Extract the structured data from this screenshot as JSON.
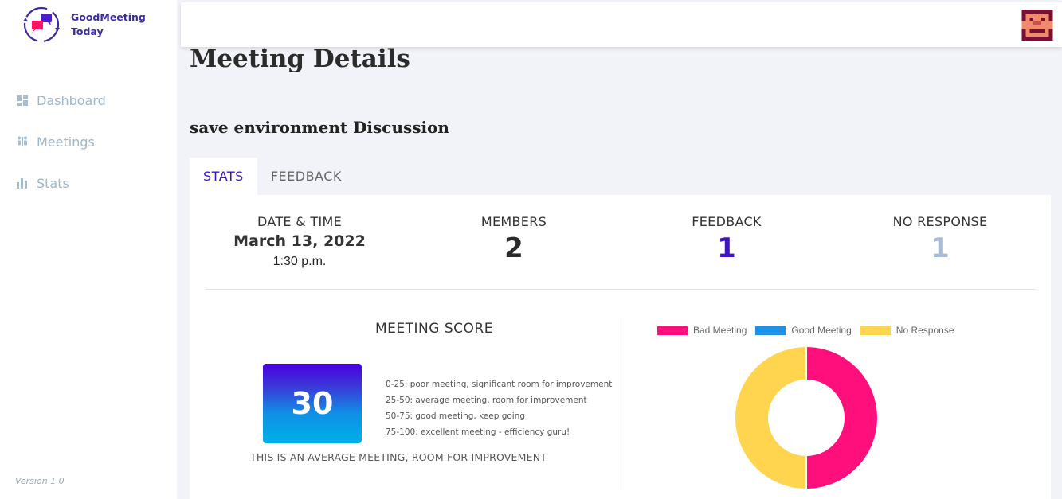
{
  "app": {
    "logo_line1": "GoodMeeting",
    "logo_line2": "Today",
    "version": "Version 1.0"
  },
  "sidebar": {
    "items": [
      {
        "label": "Dashboard",
        "icon": "dashboard-icon"
      },
      {
        "label": "Meetings",
        "icon": "meetings-icon"
      },
      {
        "label": "Stats",
        "icon": "bar-chart-icon"
      }
    ]
  },
  "header": {
    "avatar": "user-avatar"
  },
  "page": {
    "title": "Meeting Details",
    "meeting_name": "save environment Discussion"
  },
  "tabs": [
    {
      "label": "STATS",
      "active": true
    },
    {
      "label": "FEEDBACK",
      "active": false
    }
  ],
  "stats": {
    "date_label": "DATE & TIME",
    "date": "March 13, 2022",
    "time": "1:30 p.m.",
    "members_label": "MEMBERS",
    "members": "2",
    "feedback_label": "FEEDBACK",
    "feedback": "1",
    "no_response_label": "NO RESPONSE",
    "no_response": "1"
  },
  "score": {
    "title": "MEETING SCORE",
    "value": "30",
    "legend": [
      "0-25: poor meeting, significant room for improvement",
      "25-50: average meeting, room for improvement",
      "50-75: good meeting, keep going",
      "75-100: excellent meeting - efficiency guru!"
    ],
    "caption": "THIS IS AN AVERAGE MEETING, ROOM FOR IMPROVEMENT"
  },
  "colors": {
    "accent": "#3b14c4",
    "bad_meeting": "#ff0f7b",
    "good_meeting": "#1e90e8",
    "no_response": "#ffd54f",
    "no_response_text": "#a8bcd6"
  },
  "chart_data": {
    "type": "pie",
    "donut": true,
    "categories": [
      "Bad Meeting",
      "Good Meeting",
      "No Response"
    ],
    "values": [
      1,
      0,
      1
    ],
    "colors": [
      "#ff0f7b",
      "#1e90e8",
      "#ffd54f"
    ],
    "legend_position": "top"
  }
}
